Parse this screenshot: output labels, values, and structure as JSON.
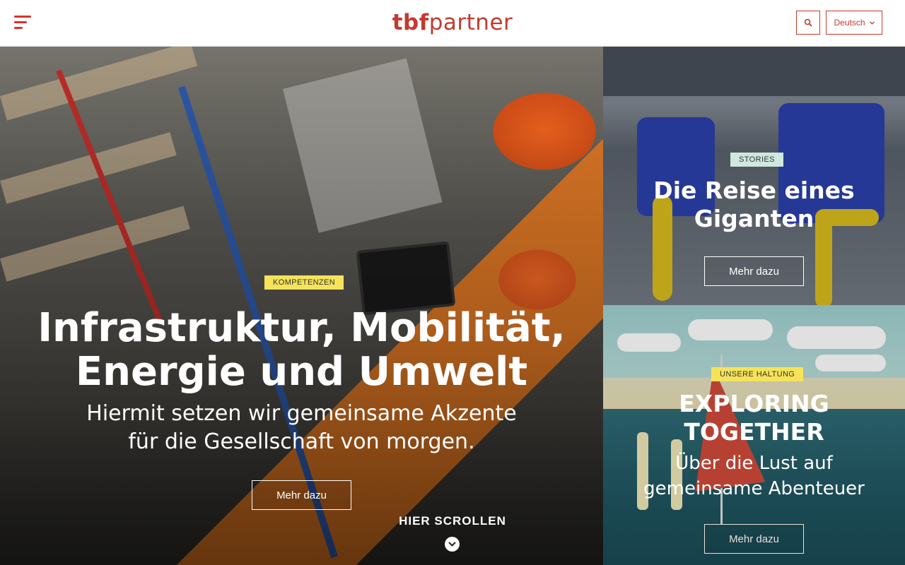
{
  "header": {
    "logo_bold": "tbf",
    "logo_light": "partner",
    "language_label": "Deutsch",
    "menu_icon": "hamburger-menu-icon",
    "search_icon": "search-icon",
    "chevron_icon": "chevron-down-icon"
  },
  "hero": {
    "tag": "KOMPETENZEN",
    "title_line1": "Infrastruktur, Mobilität,",
    "title_line2": "Energie und Umwelt",
    "subtitle_line1": "Hiermit setzen wir gemeinsame Akzente",
    "subtitle_line2": "für die Gesellschaft von morgen.",
    "button_label": "Mehr dazu",
    "scroll_label": "HIER SCROLLEN"
  },
  "stories": {
    "tag": "STORIES",
    "title_line1": "Die Reise eines",
    "title_line2": "Giganten",
    "button_label": "Mehr dazu"
  },
  "haltung": {
    "tag": "UNSERE HALTUNG",
    "title_line1": "EXPLORING",
    "title_line2": "TOGETHER",
    "subtitle_line1": "Über die Lust auf",
    "subtitle_line2": "gemeinsame Abenteuer",
    "button_label": "Mehr dazu"
  },
  "colors": {
    "brand": "#c33a2f",
    "tag_yellow": "#f6e35a",
    "tag_mint": "#cfe8df"
  }
}
